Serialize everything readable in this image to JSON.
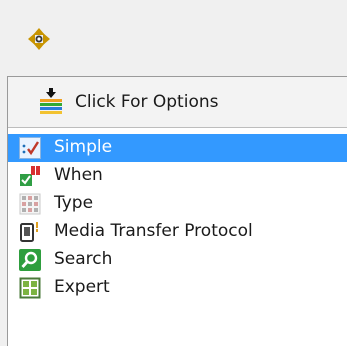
{
  "toolbar": {
    "move_handle_icon": "four-way-arrow-icon"
  },
  "options": {
    "label": "Click For Options",
    "icon": "options-download-icon"
  },
  "list": {
    "items": [
      {
        "label": "Simple",
        "icon": "simple-check-icon",
        "selected": true
      },
      {
        "label": "When",
        "icon": "when-calendar-icon",
        "selected": false
      },
      {
        "label": "Type",
        "icon": "type-grid-icon",
        "selected": false
      },
      {
        "label": "Media Transfer Protocol",
        "icon": "device-icon",
        "selected": false
      },
      {
        "label": "Search",
        "icon": "search-icon",
        "selected": false
      },
      {
        "label": "Expert",
        "icon": "expert-grid-icon",
        "selected": false
      }
    ]
  },
  "colors": {
    "selection": "#3399ff",
    "background": "#f0f0f0"
  }
}
